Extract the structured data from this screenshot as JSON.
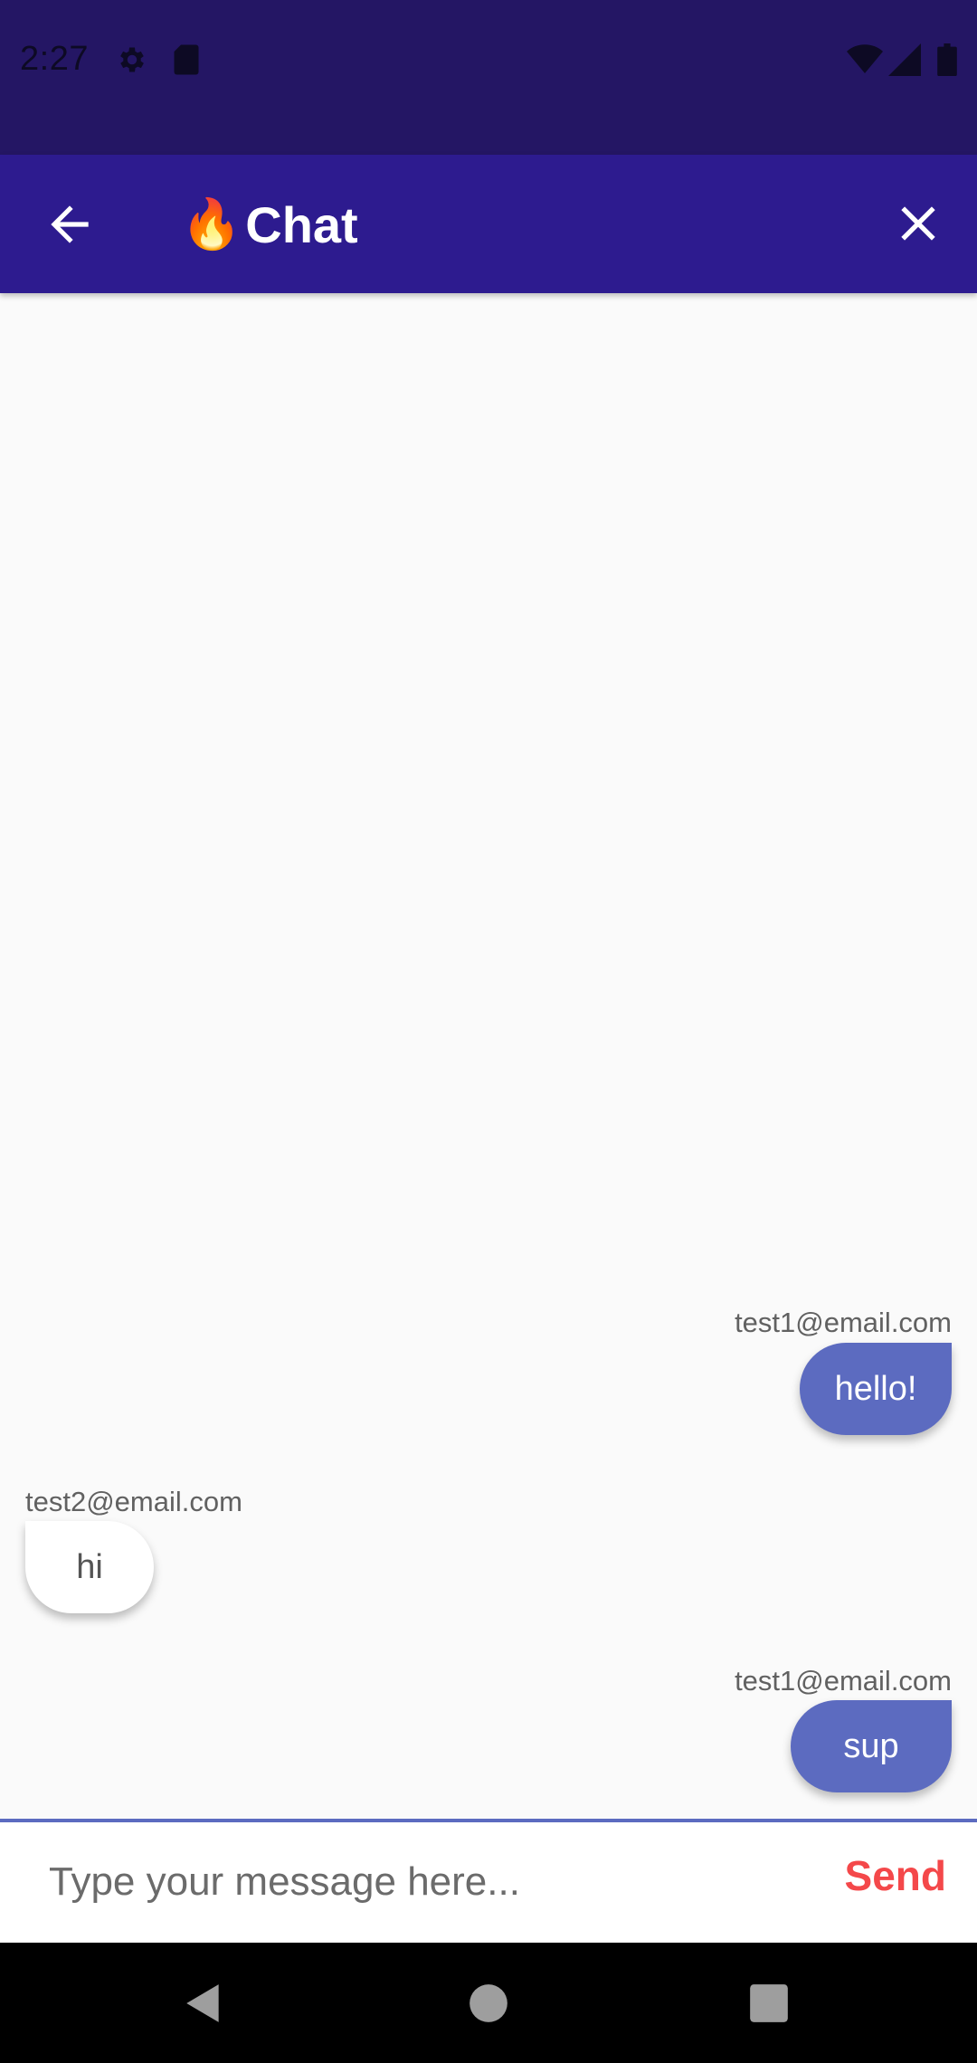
{
  "status_bar": {
    "time": "2:27",
    "icons": [
      "settings-icon",
      "sd-card-icon",
      "wifi-icon",
      "signal-icon",
      "battery-icon"
    ]
  },
  "app_bar": {
    "title_emoji": "🔥",
    "title": "Chat",
    "back_icon": "arrow-left-icon",
    "close_icon": "close-icon",
    "background": "#2d1b8f"
  },
  "messages": [
    {
      "sender": "test1@email.com",
      "text": "hello!",
      "mine": true
    },
    {
      "sender": "test2@email.com",
      "text": "hi",
      "mine": false
    },
    {
      "sender": "test1@email.com",
      "text": "sup",
      "mine": true
    }
  ],
  "composer": {
    "placeholder": "Type your message here...",
    "value": "",
    "send_label": "Send",
    "send_color": "#f4484a",
    "accent": "#5c6bc0"
  },
  "nav_bar": {
    "icons": [
      "back-triangle-icon",
      "home-circle-icon",
      "recents-square-icon"
    ]
  }
}
